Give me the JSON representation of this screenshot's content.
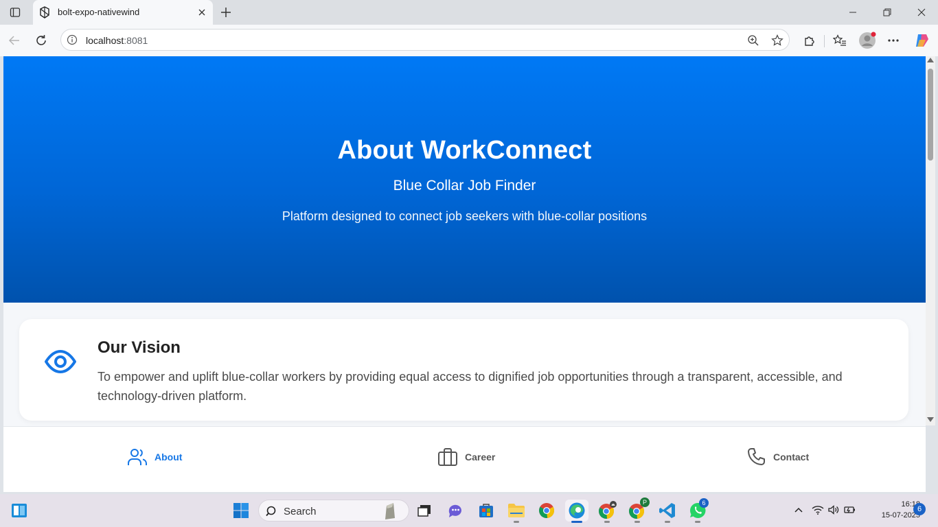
{
  "browser": {
    "tab_title": "bolt-expo-nativewind",
    "url_host": "localhost",
    "url_port": ":8081"
  },
  "hero": {
    "title": "About WorkConnect",
    "subtitle": "Blue Collar Job Finder",
    "description": "Platform designed to connect job seekers with blue-collar positions"
  },
  "vision": {
    "title": "Our Vision",
    "text": "To empower and uplift blue-collar workers by providing equal access to dignified job opportunities through a transparent, accessible, and technology-driven platform."
  },
  "bottom_nav": {
    "items": [
      {
        "label": "About",
        "icon": "users-icon",
        "active": true
      },
      {
        "label": "Career",
        "icon": "briefcase-icon",
        "active": false
      },
      {
        "label": "Contact",
        "icon": "phone-icon",
        "active": false
      }
    ]
  },
  "taskbar": {
    "search_label": "Search",
    "time": "16:18",
    "date": "15-07-2025",
    "notification_count": "6",
    "whatsapp_badge": "6",
    "chrome_profile_letter": "P"
  },
  "colors": {
    "accent": "#1677e6",
    "hero_top": "#0079f5",
    "hero_bottom": "#0052ad"
  }
}
